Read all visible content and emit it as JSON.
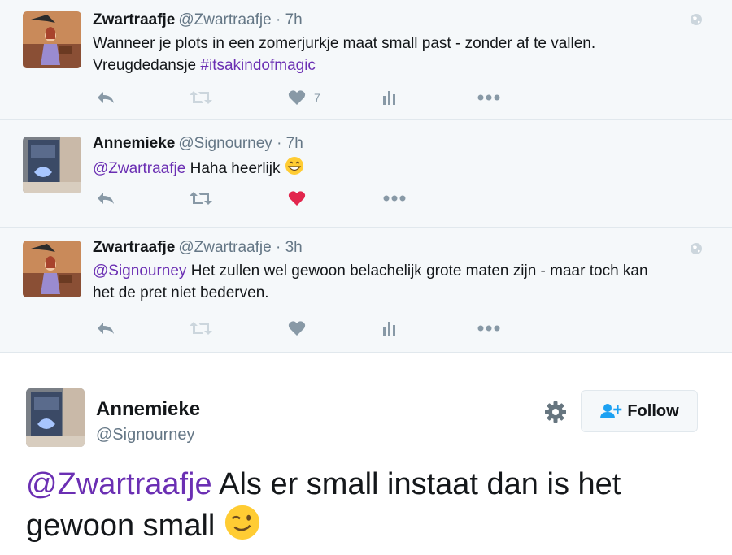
{
  "tweets": [
    {
      "name": "Zwartraafje",
      "handle": "@Zwartraafje · 7h",
      "text_plain_1": "Wanneer je plots in een zomerjurkje maat small past - zonder af te vallen.",
      "text_plain_2": "Vreugdedansje ",
      "hashtag": "#itsakindofmagic",
      "like_count": "7"
    },
    {
      "name": "Annemieke",
      "handle": "@Signourney · 7h",
      "mention": "@Zwartraafje",
      "text_plain": " Haha heerlijk ",
      "liked": true
    },
    {
      "name": "Zwartraafje",
      "handle": "@Zwartraafje · 3h",
      "mention": "@Signourney",
      "text_plain_1": " Het zullen wel gewoon belachelijk grote maten zijn - maar toch kan",
      "text_plain_2": "het de pret niet bederven."
    }
  ],
  "main_tweet": {
    "name": "Annemieke",
    "handle": "@Signourney",
    "follow_label": "Follow",
    "mention": "@Zwartraafje",
    "text_plain_1": " Als er small instaat dan is het",
    "text_plain_2": "gewoon small "
  },
  "icons": [
    "reply-icon",
    "retweet-icon",
    "like-icon",
    "analytics-icon",
    "more-icon",
    "globe-icon",
    "gear-icon",
    "follow-person-icon",
    "grin-emoji",
    "wink-emoji"
  ],
  "colors": {
    "link": "#6b2fb3",
    "muted": "#8899a6",
    "like_active": "#e2264d",
    "thread_bg": "#f5f8fa"
  }
}
